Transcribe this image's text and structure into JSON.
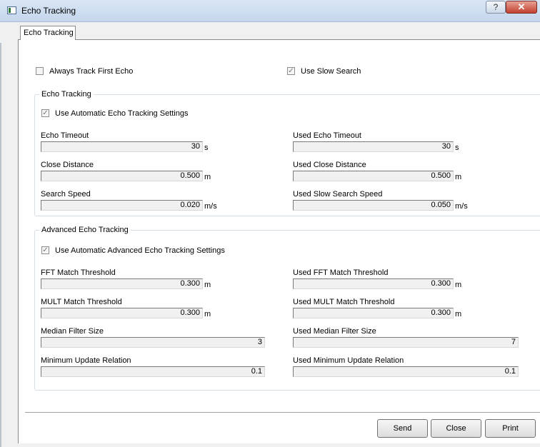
{
  "window": {
    "title": "Echo Tracking",
    "help_label": "?",
    "close_label": "✕"
  },
  "tab": {
    "label": "Echo Tracking"
  },
  "options": {
    "always_track_first_echo": {
      "label": "Always Track First Echo",
      "checked": false
    },
    "use_slow_search": {
      "label": "Use Slow Search",
      "checked": true
    }
  },
  "echo_tracking": {
    "title": "Echo Tracking",
    "use_auto": {
      "label": "Use Automatic Echo Tracking Settings",
      "checked": true
    },
    "echo_timeout": {
      "label": "Echo Timeout",
      "value": "30",
      "unit": "s"
    },
    "used_echo_timeout": {
      "label": "Used Echo Timeout",
      "value": "30",
      "unit": "s"
    },
    "close_distance": {
      "label": "Close Distance",
      "value": "0.500",
      "unit": "m"
    },
    "used_close_distance": {
      "label": "Used Close Distance",
      "value": "0.500",
      "unit": "m"
    },
    "search_speed": {
      "label": "Search Speed",
      "value": "0.020",
      "unit": "m/s"
    },
    "used_slow_search_speed": {
      "label": "Used Slow Search Speed",
      "value": "0.050",
      "unit": "m/s"
    }
  },
  "advanced": {
    "title": "Advanced Echo Tracking",
    "use_auto": {
      "label": "Use Automatic Advanced Echo Tracking Settings",
      "checked": true
    },
    "fft_match": {
      "label": "FFT Match Threshold",
      "value": "0.300",
      "unit": "m"
    },
    "used_fft_match": {
      "label": "Used FFT Match Threshold",
      "value": "0.300",
      "unit": "m"
    },
    "mult_match": {
      "label": "MULT Match Threshold",
      "value": "0.300",
      "unit": "m"
    },
    "used_mult_match": {
      "label": "Used MULT Match Threshold",
      "value": "0.300",
      "unit": "m"
    },
    "median_filter": {
      "label": "Median Filter Size",
      "value": "3"
    },
    "used_median_filter": {
      "label": "Used Median Filter Size",
      "value": "7"
    },
    "min_update": {
      "label": "Minimum Update Relation",
      "value": "0.1"
    },
    "used_min_update": {
      "label": "Used Minimum Update Relation",
      "value": "0.1"
    }
  },
  "buttons": {
    "send": "Send",
    "close": "Close",
    "print": "Print"
  },
  "check_mark": "✓"
}
